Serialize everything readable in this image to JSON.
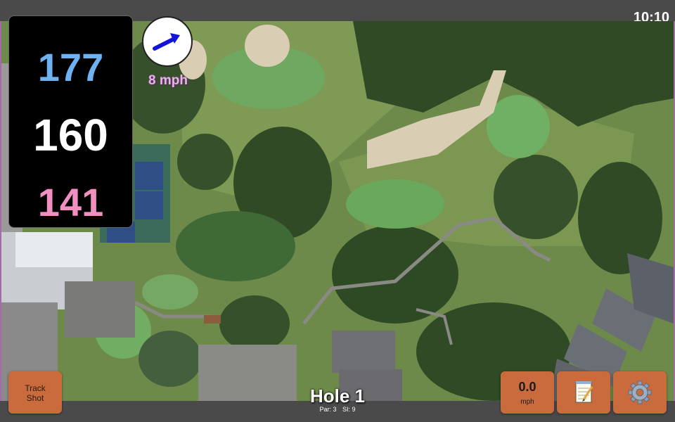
{
  "status": {
    "time": "10:10"
  },
  "distances": {
    "back": "177",
    "center": "160",
    "front": "141"
  },
  "wind": {
    "speed": "8 mph",
    "icon": "wind-arrow-icon"
  },
  "hole": {
    "title": "Hole 1",
    "par": "Par: 3",
    "stroke_index": "SI: 9"
  },
  "buttons": {
    "track_line1": "Track",
    "track_line2": "Shot",
    "speed_value": "0.0",
    "speed_unit": "mph",
    "notes_icon": "notepad-icon",
    "settings_icon": "gear-icon"
  },
  "colors": {
    "back_distance": "#6fb2f2",
    "center_distance": "#ffffff",
    "front_distance": "#f08fc0",
    "button_bg": "#c96b3d",
    "wind_text": "#e8b3ea"
  }
}
